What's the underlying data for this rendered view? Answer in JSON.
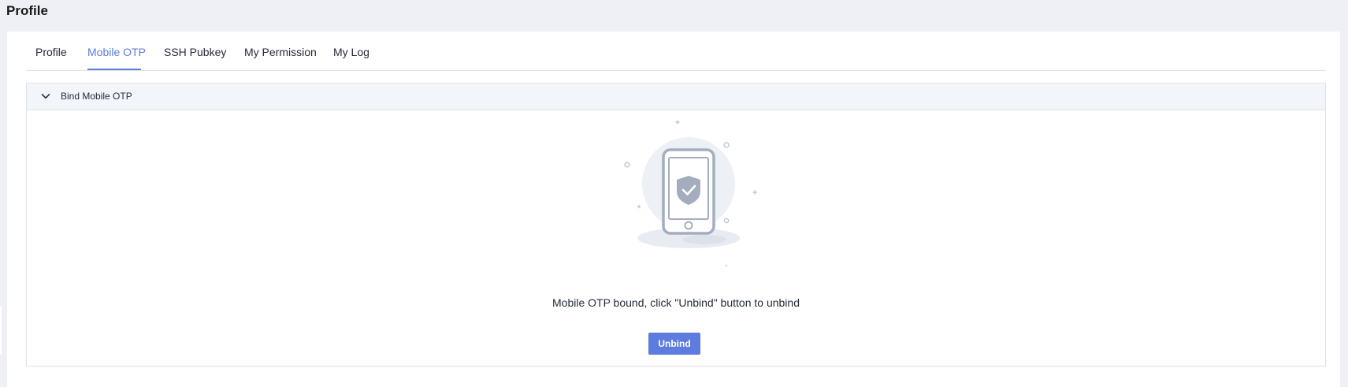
{
  "page": {
    "title": "Profile"
  },
  "tabs": [
    {
      "label": "Profile",
      "active": false
    },
    {
      "label": "Mobile OTP",
      "active": true
    },
    {
      "label": "SSH Pubkey",
      "active": false
    },
    {
      "label": "My Permission",
      "active": false
    },
    {
      "label": "My Log",
      "active": false
    }
  ],
  "panel": {
    "title": "Bind Mobile OTP",
    "expanded": true,
    "illustration_icon": "phone-shield-check-icon"
  },
  "status": {
    "message": "Mobile OTP bound, click \"Unbind\" button to unbind"
  },
  "actions": {
    "unbind_label": "Unbind"
  },
  "colors": {
    "accent": "#5e7ce0",
    "background": "#eff0f5",
    "panel_header": "#f2f5fa",
    "border": "#dfe1e6",
    "text": "#252b3a"
  }
}
